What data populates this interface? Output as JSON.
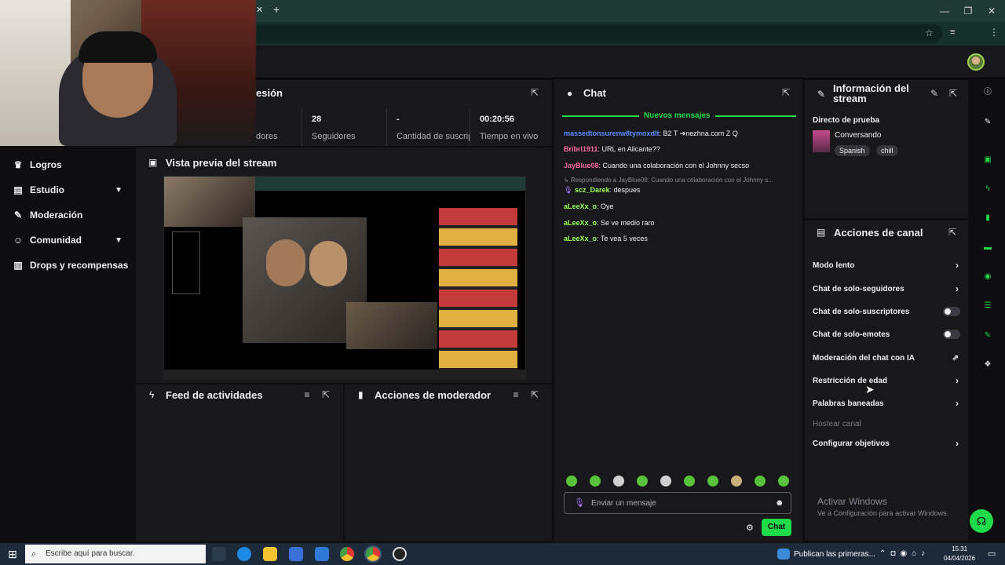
{
  "browser": {
    "new_tab": "+",
    "window_controls": {
      "minimize": "—",
      "maximize": "❐",
      "close": "✕"
    },
    "tab_close": "✕"
  },
  "sidebar": {
    "items": [
      {
        "label": "Logros",
        "icon": "trophy-icon"
      },
      {
        "label": "Estudio",
        "icon": "chart-icon",
        "expandable": true
      },
      {
        "label": "Moderación",
        "icon": "wrench-icon"
      },
      {
        "label": "Comunidad",
        "icon": "people-icon",
        "expandable": true
      },
      {
        "label": "Drops y recompensas",
        "icon": "gift-icon"
      }
    ]
  },
  "session": {
    "title_fragment": "esión",
    "stats": [
      {
        "value": "",
        "label": "dores"
      },
      {
        "value": "28",
        "label": "Seguidores"
      },
      {
        "value": "-",
        "label": "Cantidad de suscripciones"
      },
      {
        "value": "00:20:56",
        "label": "Tiempo en vivo"
      }
    ]
  },
  "preview": {
    "title": "Vista previa del stream"
  },
  "feed": {
    "title": "Feed de actividades"
  },
  "mod_actions": {
    "title": "Acciones de moderador"
  },
  "chat": {
    "title": "Chat",
    "new_messages": "Nuevos mensajes",
    "messages": [
      {
        "user": "massedtonsurenw8tymoxdlt",
        "text": ": B2 T ➔nezhna.com Z Q",
        "color": "#5b8cff"
      },
      {
        "user": "Bribri1911",
        "text": ": URL en Alicante??",
        "color": "#ff6b9e"
      },
      {
        "user": "JayBlue08",
        "text": ": Cuando una colaboración con el Johnny secso",
        "color": "#ff6b9e"
      },
      {
        "reply": "Respondiendo a JayBlue08: Cuando una colaboración con el Johnny s..."
      },
      {
        "user": "scz_Darek",
        "text": ": despues",
        "color": "#9cff57"
      },
      {
        "user": "aLeeXx_o",
        "text": ": Oye",
        "color": "#9cff57"
      },
      {
        "user": "aLeeXx_o",
        "text": ": Se ve medio raro",
        "color": "#9cff57"
      },
      {
        "user": "aLeeXx_o",
        "text": ": Te vea 5 veces",
        "color": "#9cff57"
      }
    ],
    "input_placeholder": "Enviar un mensaje",
    "send_label": "Chat"
  },
  "stream_info": {
    "title": "Información del stream",
    "stream_title": "Directo de prueba",
    "category": "Conversando",
    "tags": [
      "Spanish",
      "chill"
    ]
  },
  "channel_actions": {
    "title": "Acciones de canal",
    "items": [
      {
        "label": "Modo lento",
        "kind": "arrow"
      },
      {
        "label": "Chat de solo-seguidores",
        "kind": "arrow"
      },
      {
        "label": "Chat de solo-suscriptores",
        "kind": "toggle",
        "on": false
      },
      {
        "label": "Chat de solo-emotes",
        "kind": "toggle",
        "on": false
      },
      {
        "label": "Moderación del chat con IA",
        "kind": "external"
      },
      {
        "label": "Restricción de edad",
        "kind": "arrow"
      },
      {
        "label": "Palabras baneadas",
        "kind": "arrow"
      },
      {
        "label": "Hostear canal",
        "kind": "disabled"
      },
      {
        "label": "Configurar objetivos",
        "kind": "arrow"
      }
    ]
  },
  "activation": {
    "title": "Activar Windows",
    "subtitle": "Ve a Configuración para activar Windows."
  },
  "taskbar": {
    "search_placeholder": "Escribe aquí para buscar.",
    "news": "Publican las primeras...",
    "time": "15:31",
    "date": "04/04/2026"
  },
  "colors": {
    "accent": "#1fdb4a",
    "panel": "#18181b",
    "background": "#0e0e10"
  }
}
